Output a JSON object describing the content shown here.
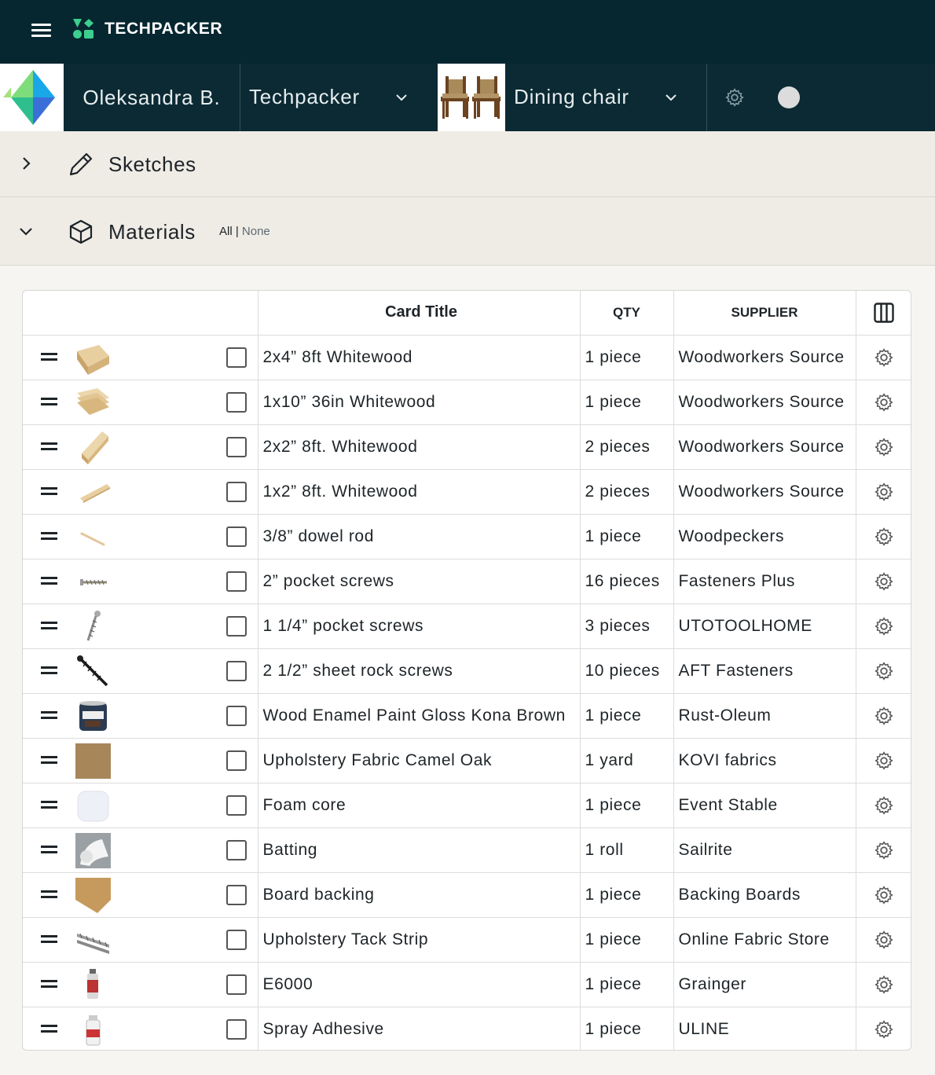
{
  "app": {
    "brand": "TECHPACKER",
    "colors": {
      "topbar": "#062730",
      "accent_green": "#3ccf8e"
    }
  },
  "context": {
    "user": "Oleksandra B.",
    "company": "Techpacker",
    "product": "Dining chair"
  },
  "sections": {
    "sketches": {
      "title": "Sketches",
      "expanded": false
    },
    "materials": {
      "title": "Materials",
      "expanded": true,
      "all_label": "All |",
      "none_label": "None"
    }
  },
  "table": {
    "headers": {
      "title": "Card Title",
      "qty": "QTY",
      "supplier": "SUPPLIER"
    },
    "rows": [
      {
        "title": "2x4” 8ft Whitewood",
        "qty": "1 piece",
        "supplier": "Woodworkers Source",
        "thumb": "lumber-2x4"
      },
      {
        "title": "1x10” 36in Whitewood",
        "qty": "1 piece",
        "supplier": "Woodworkers Source",
        "thumb": "board-1x10"
      },
      {
        "title": "2x2” 8ft. Whitewood",
        "qty": "2 pieces",
        "supplier": "Woodworkers Source",
        "thumb": "lumber-2x2"
      },
      {
        "title": "1x2” 8ft. Whitewood",
        "qty": "2 pieces",
        "supplier": "Woodworkers Source",
        "thumb": "strip-1x2"
      },
      {
        "title": "3/8” dowel rod",
        "qty": "1 piece",
        "supplier": "Woodpeckers",
        "thumb": "dowel"
      },
      {
        "title": "2” pocket screws",
        "qty": "16 pieces",
        "supplier": "Fasteners Plus",
        "thumb": "screw-horizontal"
      },
      {
        "title": "1 1/4” pocket screws",
        "qty": "3 pieces",
        "supplier": "UTOTOOLHOME",
        "thumb": "screw-vertical"
      },
      {
        "title": "2 1/2” sheet rock screws",
        "qty": "10 pieces",
        "supplier": "AFT Fasteners",
        "thumb": "black-screw"
      },
      {
        "title": "Wood Enamel Paint Gloss Kona Brown",
        "qty": "1 piece",
        "supplier": "Rust-Oleum",
        "thumb": "paint-can"
      },
      {
        "title": "Upholstery Fabric Camel Oak",
        "qty": "1 yard",
        "supplier": "KOVI fabrics",
        "thumb": "fabric-swatch"
      },
      {
        "title": "Foam core",
        "qty": "1 piece",
        "supplier": "Event Stable",
        "thumb": "foam-cushion"
      },
      {
        "title": "Batting",
        "qty": "1 roll",
        "supplier": "Sailrite",
        "thumb": "batting-roll"
      },
      {
        "title": "Board backing",
        "qty": "1 piece",
        "supplier": "Backing Boards",
        "thumb": "board-backing"
      },
      {
        "title": "Upholstery Tack Strip",
        "qty": "1 piece",
        "supplier": "Online Fabric Store",
        "thumb": "tack-strip"
      },
      {
        "title": "E6000",
        "qty": "1 piece",
        "supplier": "Grainger",
        "thumb": "glue-tube"
      },
      {
        "title": "Spray Adhesive",
        "qty": "1 piece",
        "supplier": "ULINE",
        "thumb": "spray-can"
      }
    ]
  }
}
